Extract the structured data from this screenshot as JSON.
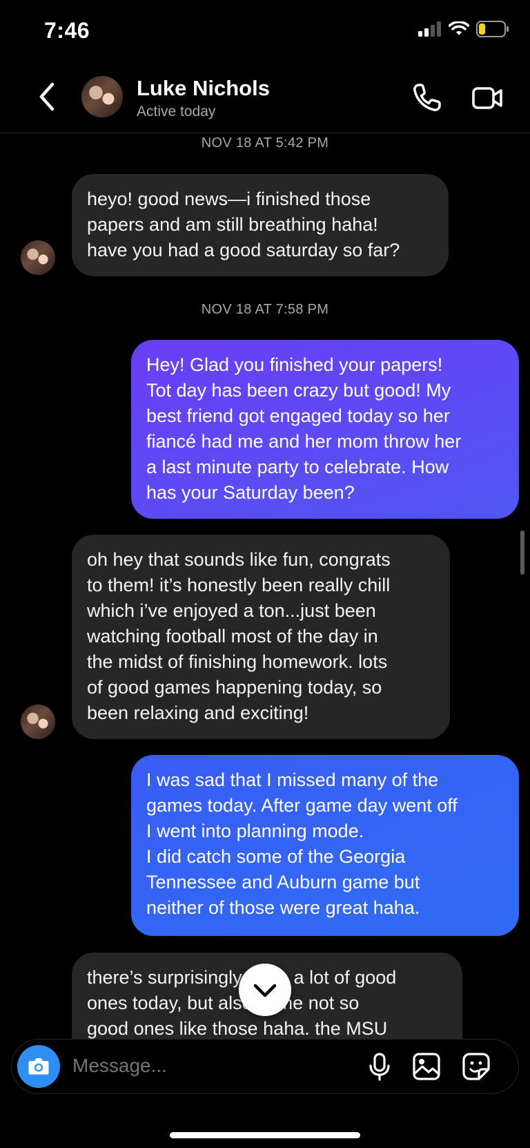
{
  "status_bar": {
    "time": "7:46"
  },
  "header": {
    "name": "Luke Nichols",
    "status": "Active today",
    "icons": [
      "back-chevron-icon",
      "phone-icon",
      "video-call-icon"
    ]
  },
  "conversation": {
    "timestamps": [
      "NOV 18 AT 5:42 PM",
      "NOV 18 AT 7:58 PM"
    ],
    "messages": [
      {
        "from": "them",
        "text": "heyo! good news—i finished those\npapers and am still breathing haha!\nhave you had a good saturday so far?"
      },
      {
        "from": "me",
        "text": "Hey! Glad you finished your papers!\nTot day has been crazy but good! My\nbest friend got engaged today so her\nfiancé had me and her mom throw her\na last minute party to celebrate. How\nhas your Saturday been?"
      },
      {
        "from": "them",
        "text": "oh hey that sounds like fun, congrats\nto them! it’s honestly been really chill\nwhich i’ve enjoyed a ton...just been\nwatching football most of the day in\nthe midst of finishing homework. lots\nof good games happening today, so\nbeen relaxing and exciting!"
      },
      {
        "from": "me",
        "text": "I was sad that I missed many of the\ngames today. After game day went off\nI went into planning mode.\nI did catch some of the Georgia\nTennessee and Auburn game but\nneither of those were great haha."
      },
      {
        "from": "them",
        "text": "there’s surprisingly been a lot of good\nones today, but also some not so\ngood ones like those haha. the MSU"
      }
    ]
  },
  "composer": {
    "placeholder": "Message..."
  },
  "colors": {
    "incoming_bubble": "#262626",
    "outgoing_purple": "#5b4cf4",
    "outgoing_blue": "#2f6df3",
    "camera_button": "#2f8ff0"
  }
}
